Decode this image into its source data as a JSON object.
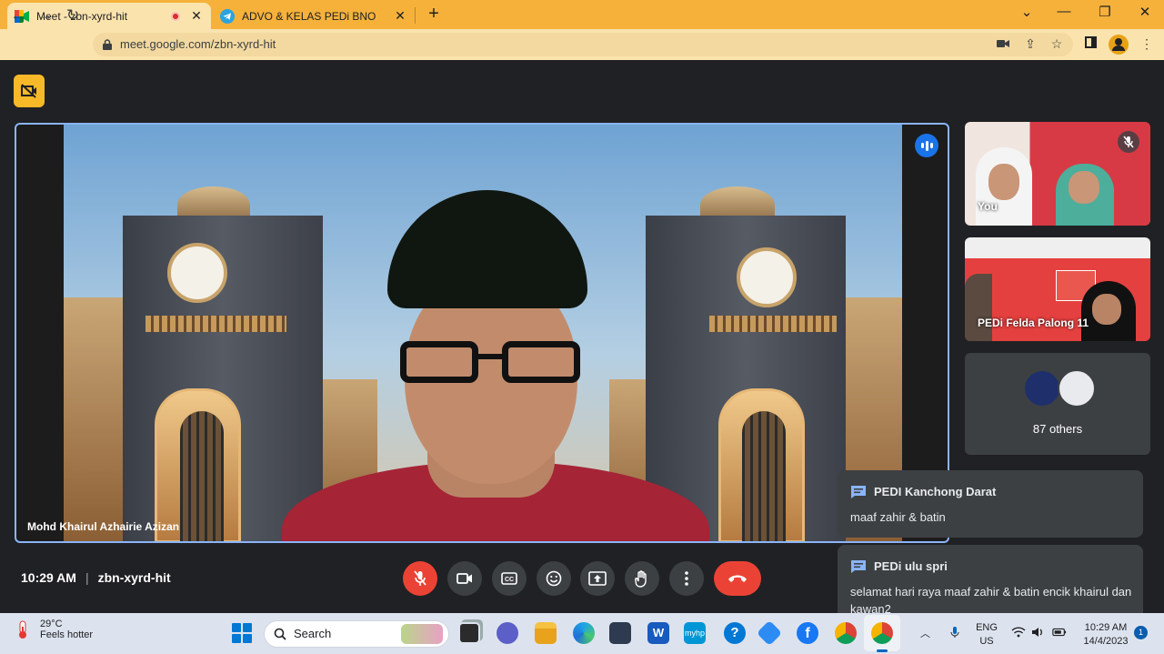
{
  "browser": {
    "tabs": [
      {
        "title": "Meet - zbn-xyrd-hit",
        "active": true,
        "recording": true
      },
      {
        "title": "ADVO & KELAS PEDi BNO",
        "active": false
      }
    ],
    "new_tab": "+",
    "window_controls": {
      "minimize": "—",
      "restore": "❐",
      "close": "✕",
      "tab_search": "⌄"
    },
    "url": "meet.google.com/zbn-xyrd-hit",
    "accent_color": "#f5b13a"
  },
  "meet": {
    "main_speaker": "Mohd Khairul Azhairie Azizan",
    "participants": [
      {
        "label": "You",
        "muted": true
      },
      {
        "label": "PEDi Felda Palong 11"
      }
    ],
    "others_label": "87 others",
    "chat_toasts": [
      {
        "from": "PEDI Kanchong Darat",
        "message": "maaf zahir & batin"
      },
      {
        "from": "PEDi ulu spri",
        "message": "selamat hari raya maaf zahir & batin encik khairul dan kawan2"
      }
    ],
    "time": "10:29 AM",
    "separator": "|",
    "meeting_code": "zbn-xyrd-hit",
    "controls": [
      "mic-off-icon",
      "camera-icon",
      "captions-icon",
      "emoji-icon",
      "present-icon",
      "raise-hand-icon",
      "more-icon",
      "leave-call-icon"
    ],
    "leave_color": "#ea4335"
  },
  "taskbar": {
    "temperature": "29°C",
    "weather_desc": "Feels hotter",
    "search_label": "Search",
    "lang_line1": "ENG",
    "lang_line2": "US",
    "time": "10:29 AM",
    "date": "14/4/2023",
    "notifications": "1"
  }
}
